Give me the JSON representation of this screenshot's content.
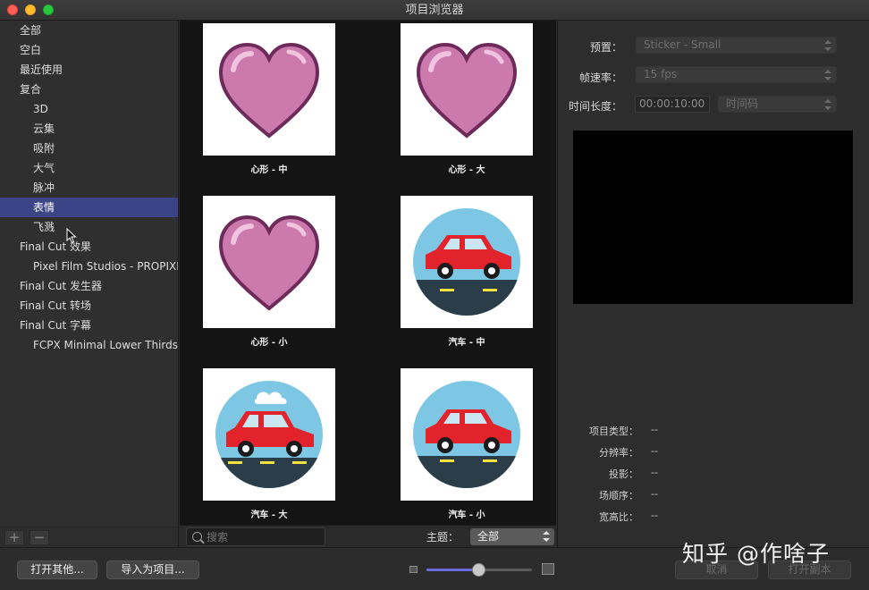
{
  "window": {
    "title": "项目浏览器"
  },
  "sidebar": {
    "items": [
      {
        "label": "全部",
        "level": 1,
        "selected": false
      },
      {
        "label": "空白",
        "level": 1,
        "selected": false
      },
      {
        "label": "最近使用",
        "level": 1,
        "selected": false
      },
      {
        "label": "复合",
        "level": 1,
        "selected": false
      },
      {
        "label": "3D",
        "level": 2,
        "selected": false
      },
      {
        "label": "云集",
        "level": 2,
        "selected": false
      },
      {
        "label": "吸附",
        "level": 2,
        "selected": false
      },
      {
        "label": "大气",
        "level": 2,
        "selected": false
      },
      {
        "label": "脉冲",
        "level": 2,
        "selected": false
      },
      {
        "label": "表情",
        "level": 2,
        "selected": true
      },
      {
        "label": "飞溅",
        "level": 2,
        "selected": false
      },
      {
        "label": "Final Cut 效果",
        "level": 1,
        "selected": false
      },
      {
        "label": "Pixel Film Studios - PROPIXIE",
        "level": 2,
        "selected": false
      },
      {
        "label": "Final Cut 发生器",
        "level": 1,
        "selected": false
      },
      {
        "label": "Final Cut 转场",
        "level": 1,
        "selected": false
      },
      {
        "label": "Final Cut 字幕",
        "level": 1,
        "selected": false
      },
      {
        "label": "FCPX Minimal Lower Thirds",
        "level": 2,
        "selected": false
      }
    ],
    "add_label": "+",
    "remove_label": "−"
  },
  "browser": {
    "tiles": [
      {
        "label": "心形 - 中",
        "icon": "heart-icon"
      },
      {
        "label": "心形 - 大",
        "icon": "heart-icon"
      },
      {
        "label": "心形 - 小",
        "icon": "heart-icon"
      },
      {
        "label": "汽车 - 中",
        "icon": "car-icon"
      },
      {
        "label": "汽车 - 大",
        "icon": "car-with-cloud-icon"
      },
      {
        "label": "汽车 - 小",
        "icon": "car-icon"
      }
    ],
    "search_placeholder": "搜索",
    "theme_label": "主题：",
    "theme_value": "全部"
  },
  "inspector": {
    "preset_label": "预置：",
    "preset_value": "Sticker - Small",
    "framerate_label": "帧速率：",
    "framerate_value": "15 fps",
    "duration_label": "时间长度：",
    "duration_value": "00:00:10:00",
    "duration_unit": "时间码",
    "info": [
      {
        "label": "项目类型：",
        "value": "--"
      },
      {
        "label": "分辨率：",
        "value": "--"
      },
      {
        "label": "投影：",
        "value": "--"
      },
      {
        "label": "场顺序：",
        "value": "--"
      },
      {
        "label": "宽高比：",
        "value": "--"
      }
    ]
  },
  "footer": {
    "open_other": "打开其他...",
    "import_as_project": "导入为项目...",
    "cancel": "取消",
    "open_copy": "打开副本",
    "zoom_level": 0.5
  },
  "watermark": "知乎 @作啥子",
  "colors": {
    "selection": "#3b4486",
    "heart": "#cc79ae",
    "car_body": "#e3232b",
    "sky": "#7dc7e4",
    "slider_fill": "#6b6bde"
  }
}
